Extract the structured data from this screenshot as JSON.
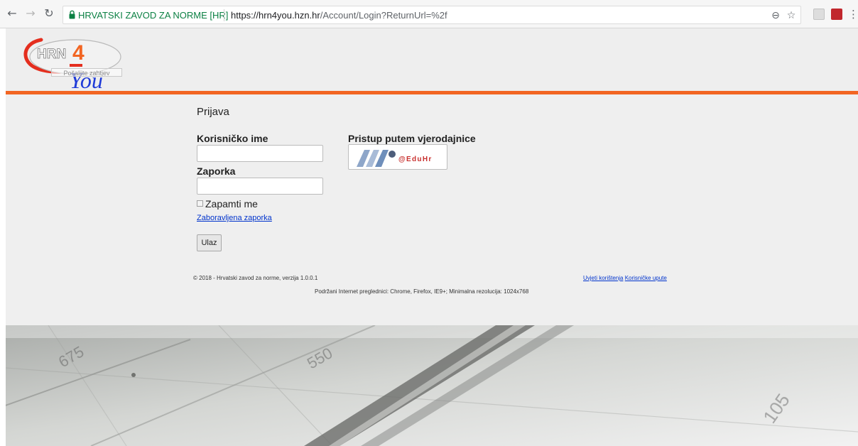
{
  "browser": {
    "secure_label": "HRVATSKI ZAVOD ZA NORME [HR]",
    "url_host": "https://hrn4you.hzn.hr",
    "url_path": "/Account/Login?ReturnUrl=%2f",
    "icons": [
      "back-icon",
      "forward-icon",
      "reload-icon",
      "lock-icon",
      "zoom-icon",
      "star-icon",
      "extension-icon",
      "pdf-extension-icon",
      "menu-icon"
    ],
    "secure_color": "#0b8043"
  },
  "header": {
    "logo_text": "HRN4You",
    "logo_subtext": "Pošaljite zahtjev",
    "accent_color": "#f26522"
  },
  "login": {
    "title": "Prijava",
    "username_label": "Korisničko ime",
    "username_value": "",
    "password_label": "Zaporka",
    "password_value": "",
    "remember_label": "Zapamti me",
    "remember_checked": false,
    "forgot_link": "Zaboravljena zaporka",
    "submit_label": "Ulaz"
  },
  "federated": {
    "heading": "Pristup putem vjerodajnice",
    "provider_label": "@EduHr"
  },
  "footer": {
    "copyright": "© 2018 - Hrvatski zavod za norme, verzija 1.0.0.1",
    "terms_link": "Uvjeti korištenja",
    "manual_link": "Korisničke upute",
    "browsers_note": "Podržani Internet preglednici: Chrome, Firefox, IE9+; Minimalna rezolucija: 1024x768"
  }
}
